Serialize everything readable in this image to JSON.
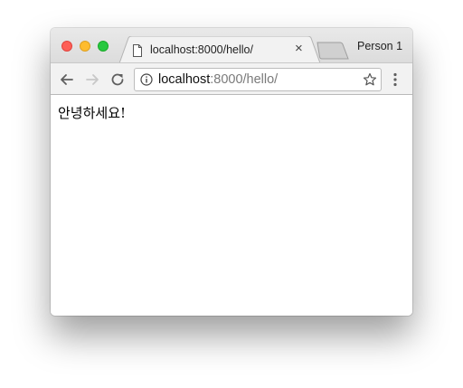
{
  "window": {
    "controls": [
      "close",
      "minimize",
      "maximize"
    ]
  },
  "tab": {
    "title": "localhost:8000/hello/",
    "close_glyph": "×",
    "favicon": "page-icon"
  },
  "profile": {
    "label": "Person 1"
  },
  "toolbar": {
    "back_icon": "arrow-left-icon",
    "forward_icon": "arrow-right-icon",
    "reload_icon": "reload-icon",
    "menu_icon": "kebab-menu-icon"
  },
  "omnibox": {
    "host": "localhost",
    "rest": ":8000/hello/",
    "info_icon": "info-icon",
    "bookmark_icon": "star-icon"
  },
  "page": {
    "text": "안녕하세요!"
  },
  "colors": {
    "close": "#fe5f57",
    "minimize": "#febc2e",
    "maximize": "#28c840"
  }
}
